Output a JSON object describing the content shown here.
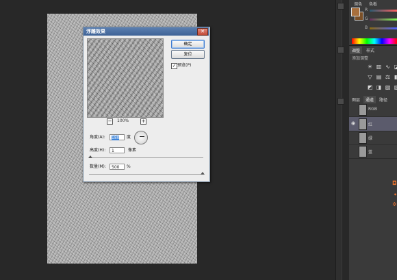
{
  "dialog": {
    "title": "浮雕效果",
    "close_symbol": "✕",
    "ok_label": "确定",
    "reset_label": "复位",
    "preview_label": "预览(P)",
    "preview_checked": true,
    "zoom_out": "−",
    "zoom_in": "+",
    "zoom_value": "100%",
    "angle_label": "角度(A):",
    "angle_value": "180",
    "angle_unit": "度",
    "height_label": "高度(H):",
    "height_value": "1",
    "height_unit": "像素",
    "amount_label": "数量(M):",
    "amount_value": "500",
    "amount_unit": "%"
  },
  "panels": {
    "color_tabs": [
      "调色",
      "色板"
    ],
    "slider_labels": [
      "R",
      "G",
      "B"
    ],
    "adjust_tabs": [
      "调整",
      "样式"
    ],
    "adjust_hint": "添加调整",
    "layer_tabs": [
      "图层",
      "通道",
      "路径"
    ],
    "channels": [
      {
        "name": "RGB",
        "visible": false,
        "selected": false
      },
      {
        "name": "红",
        "visible": true,
        "selected": true
      },
      {
        "name": "绿",
        "visible": false,
        "selected": false
      },
      {
        "name": "蓝",
        "visible": false,
        "selected": false
      }
    ]
  },
  "colors": {
    "foreground": "#a86f3c",
    "dialog_title_bar": "#4a6fa5",
    "selected_channel": "#5b5b6c"
  }
}
